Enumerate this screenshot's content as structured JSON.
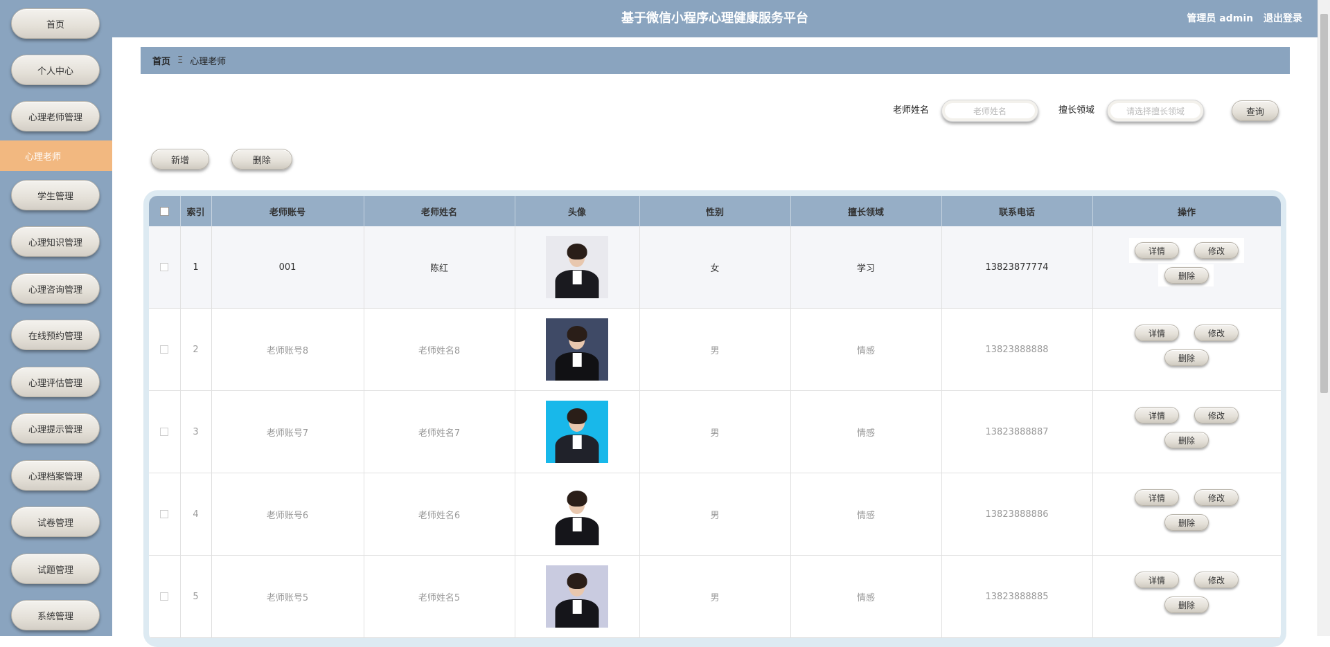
{
  "header": {
    "title": "基于微信小程序心理健康服务平台",
    "role": "管理员 admin",
    "logout": "退出登录"
  },
  "sidebar": {
    "items": [
      {
        "label": "首页"
      },
      {
        "label": "个人中心"
      },
      {
        "label": "心理老师管理"
      },
      {
        "label": "心理老师"
      },
      {
        "label": "学生管理"
      },
      {
        "label": "心理知识管理"
      },
      {
        "label": "心理咨询管理"
      },
      {
        "label": "在线预约管理"
      },
      {
        "label": "心理评估管理"
      },
      {
        "label": "心理提示管理"
      },
      {
        "label": "心理档案管理"
      },
      {
        "label": "试卷管理"
      },
      {
        "label": "试题管理"
      },
      {
        "label": "系统管理"
      }
    ],
    "active_index": 3
  },
  "breadcrumb": {
    "home": "首页",
    "separator": "Ξ",
    "current": "心理老师"
  },
  "search": {
    "name_label": "老师姓名",
    "name_placeholder": "老师姓名",
    "field_label": "擅长领域",
    "field_placeholder": "请选择擅长领域",
    "query_button": "查询"
  },
  "actions": {
    "add": "新增",
    "delete": "删除"
  },
  "table": {
    "columns": [
      "索引",
      "老师账号",
      "老师姓名",
      "头像",
      "性别",
      "擅长领域",
      "联系电话",
      "操作"
    ],
    "rows": [
      {
        "index": "1",
        "account": "001",
        "name": "陈红",
        "gender": "女",
        "field": "学习",
        "phone": "13823877774",
        "avatar_bg": "#e9e9ee",
        "body": "#1a1a1f"
      },
      {
        "index": "2",
        "account": "老师账号8",
        "name": "老师姓名8",
        "gender": "男",
        "field": "情感",
        "phone": "13823888888",
        "avatar_bg": "#3f4a66",
        "body": "#111114"
      },
      {
        "index": "3",
        "account": "老师账号7",
        "name": "老师姓名7",
        "gender": "男",
        "field": "情感",
        "phone": "13823888887",
        "avatar_bg": "#18b8ea",
        "body": "#20222a"
      },
      {
        "index": "4",
        "account": "老师账号6",
        "name": "老师姓名6",
        "gender": "男",
        "field": "情感",
        "phone": "13823888886",
        "avatar_bg": "#ffffff",
        "body": "#15151a"
      },
      {
        "index": "5",
        "account": "老师账号5",
        "name": "老师姓名5",
        "gender": "男",
        "field": "情感",
        "phone": "13823888885",
        "avatar_bg": "#c9cbe0",
        "body": "#15151a"
      }
    ],
    "op_labels": {
      "detail": "详情",
      "edit": "修改",
      "delete": "删除"
    }
  },
  "colors": {
    "header": "#8aa4bf",
    "active_menu": "#f2b880",
    "table_header": "#96aec6"
  }
}
